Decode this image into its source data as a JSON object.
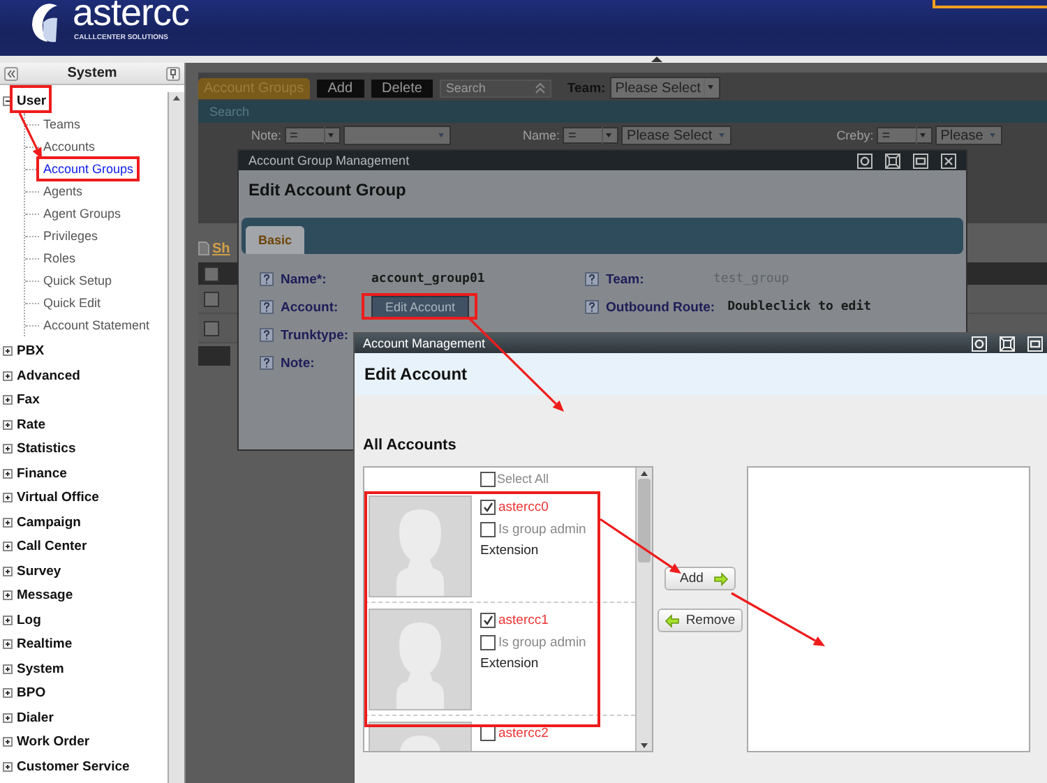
{
  "header": {
    "logo": "astercc",
    "tagline": "CALLLCENTER SOLUTIONS"
  },
  "sidebar": {
    "title": "System",
    "tree": [
      {
        "label": "User",
        "expanded": true,
        "selected": false,
        "children": [
          {
            "label": "Teams",
            "selected": false
          },
          {
            "label": "Accounts",
            "selected": false
          },
          {
            "label": "Account Groups",
            "selected": true
          },
          {
            "label": "Agents",
            "selected": false
          },
          {
            "label": "Agent Groups",
            "selected": false
          },
          {
            "label": "Privileges",
            "selected": false
          },
          {
            "label": "Roles",
            "selected": false
          },
          {
            "label": "Quick Setup",
            "selected": false
          },
          {
            "label": "Quick Edit",
            "selected": false
          },
          {
            "label": "Account Statement",
            "selected": false
          }
        ]
      },
      {
        "label": "PBX",
        "expanded": false,
        "selected": false
      },
      {
        "label": "Advanced",
        "expanded": false,
        "selected": false
      },
      {
        "label": "Fax",
        "expanded": false,
        "selected": false
      },
      {
        "label": "Rate",
        "expanded": false,
        "selected": false
      },
      {
        "label": "Statistics",
        "expanded": false,
        "selected": false
      },
      {
        "label": "Finance",
        "expanded": false,
        "selected": false
      },
      {
        "label": "Virtual Office",
        "expanded": false,
        "selected": false
      },
      {
        "label": "Campaign",
        "expanded": false,
        "selected": false
      },
      {
        "label": "Call Center",
        "expanded": false,
        "selected": false
      },
      {
        "label": "Survey",
        "expanded": false,
        "selected": false
      },
      {
        "label": "Message",
        "expanded": false,
        "selected": false
      },
      {
        "label": "Log",
        "expanded": false,
        "selected": false
      },
      {
        "label": "Realtime",
        "expanded": false,
        "selected": false
      },
      {
        "label": "System",
        "expanded": false,
        "selected": false
      },
      {
        "label": "BPO",
        "expanded": false,
        "selected": false
      },
      {
        "label": "Dialer",
        "expanded": false,
        "selected": false
      },
      {
        "label": "Work Order",
        "expanded": false,
        "selected": false
      },
      {
        "label": "Customer Service",
        "expanded": false,
        "selected": false
      }
    ]
  },
  "toolbar": {
    "tabs": [
      {
        "label": "Account Groups",
        "selected": true
      }
    ],
    "buttons": [
      "Add",
      "Delete"
    ],
    "search_select": "Search",
    "team": {
      "label": "Team:",
      "value": "Please Select"
    }
  },
  "search_panel": {
    "title": "Search",
    "filters": [
      {
        "label": "Note:",
        "operator": "="
      },
      {
        "label": "Name:",
        "operator": "=",
        "value": "Please Select"
      },
      {
        "label": "Creby:",
        "operator": "=",
        "value": "Please"
      }
    ]
  },
  "table": {
    "link": "Sh",
    "select_all_checked": false,
    "rows": [
      {
        "checked": false
      },
      {
        "checked": false
      }
    ]
  },
  "group_window": {
    "title": "Account Group Management",
    "heading": "Edit Account Group",
    "tabs": [
      {
        "label": "Basic",
        "selected": true
      }
    ],
    "columns": [
      [
        {
          "kind": "text",
          "label": "Name*:",
          "value": "account_group01",
          "muted": false
        },
        {
          "kind": "button",
          "label": "Account:",
          "value": "Edit Account"
        },
        {
          "kind": "label",
          "label": "Trunktype:"
        },
        {
          "kind": "label",
          "label": "Note:"
        }
      ],
      [
        {
          "kind": "text",
          "label": "Team:",
          "value": "test_group",
          "muted": true
        },
        {
          "kind": "text",
          "label": "Outbound Route:",
          "value": "Doubleclick to edit",
          "muted": false
        }
      ]
    ]
  },
  "account_window": {
    "title": "Account Management",
    "heading": "Edit Account",
    "section": "All Accounts",
    "select_all": {
      "label": "Select All",
      "checked": false
    },
    "accounts": [
      {
        "name": "astercc0",
        "checked": true,
        "admin": {
          "label": "Is group admin",
          "checked": false
        },
        "extension": "Extension"
      },
      {
        "name": "astercc1",
        "checked": true,
        "admin": {
          "label": "Is group admin",
          "checked": false
        },
        "extension": "Extension"
      },
      {
        "name": "astercc2",
        "checked": false
      }
    ],
    "buttons": [
      {
        "kind": "add",
        "label": "Add"
      },
      {
        "kind": "remove",
        "label": "Remove"
      }
    ]
  }
}
